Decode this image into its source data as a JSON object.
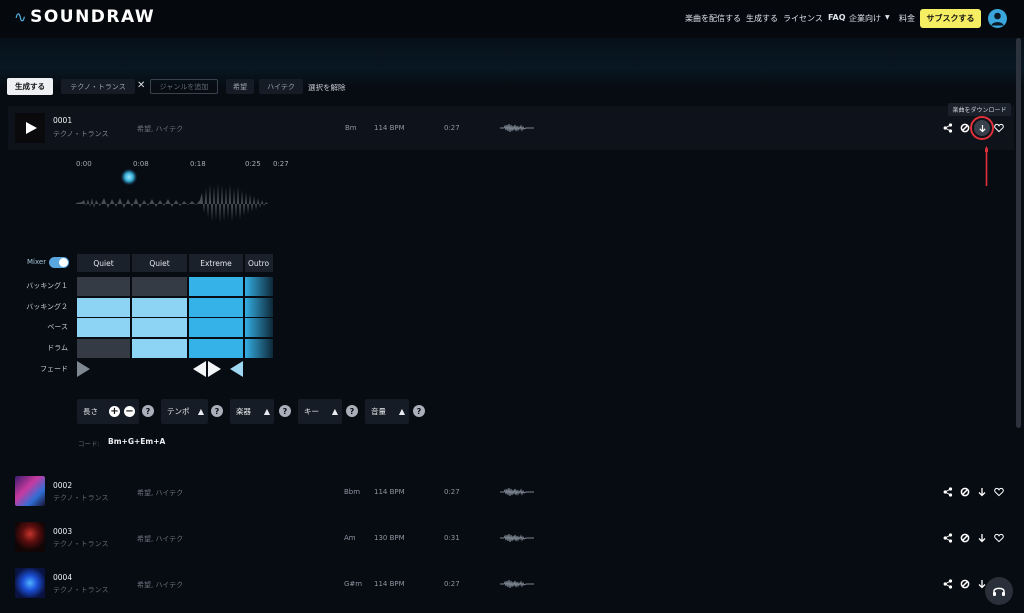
{
  "brand": {
    "name": "SOUNDRAW",
    "mark": "∿"
  },
  "nav": {
    "items": [
      "楽曲を配信する",
      "生成する",
      "ライセンス",
      "FAQ",
      "企業向け",
      "料金"
    ],
    "subscribe": "サブスクする"
  },
  "filters": {
    "generate": "生成する",
    "genre": "テクノ・トランス",
    "genre_placeholder": "ジャンルを追加",
    "moods": [
      "希望",
      "ハイテク"
    ],
    "clear": "選択を解除"
  },
  "tracks": [
    {
      "id": "0001",
      "genre": "テクノ・トランス",
      "tags": "希望, ハイテク",
      "key": "Bm",
      "bpm": "114 BPM",
      "length": "0:27"
    },
    {
      "id": "0002",
      "genre": "テクノ・トランス",
      "tags": "希望, ハイテク",
      "key": "Bbm",
      "bpm": "114 BPM",
      "length": "0:27"
    },
    {
      "id": "0003",
      "genre": "テクノ・トランス",
      "tags": "希望, ハイテク",
      "key": "Am",
      "bpm": "130 BPM",
      "length": "0:31"
    },
    {
      "id": "0004",
      "genre": "テクノ・トランス",
      "tags": "希望, ハイテク",
      "key": "G#m",
      "bpm": "114 BPM",
      "length": "0:27"
    }
  ],
  "tooltip": "楽曲をダウンロード",
  "timeline": [
    "0:00",
    "0:08",
    "0:18",
    "0:25",
    "0:27"
  ],
  "mixer": {
    "label": "Mixer",
    "sections": [
      "Quiet",
      "Quiet",
      "Extreme",
      "Outro"
    ],
    "lanes": [
      "バッキング１",
      "バッキング２",
      "ベース",
      "ドラム",
      "フェード"
    ],
    "grid": [
      [
        "off",
        "off",
        "md",
        "md"
      ],
      [
        "lt",
        "lt",
        "md",
        "md"
      ],
      [
        "lt",
        "lt",
        "md",
        "md"
      ],
      [
        "off",
        "lt",
        "md",
        "md"
      ]
    ]
  },
  "controls": {
    "length": "長さ",
    "tempo": "テンポ",
    "instrument": "楽器",
    "key": "キー",
    "volume": "音量",
    "chords_label": "コード:",
    "chords": "Bm+G+Em+A"
  },
  "colors": {
    "accent": "#35b2e8",
    "subscribe": "#f6ee62",
    "highlight": "#e0303a"
  }
}
